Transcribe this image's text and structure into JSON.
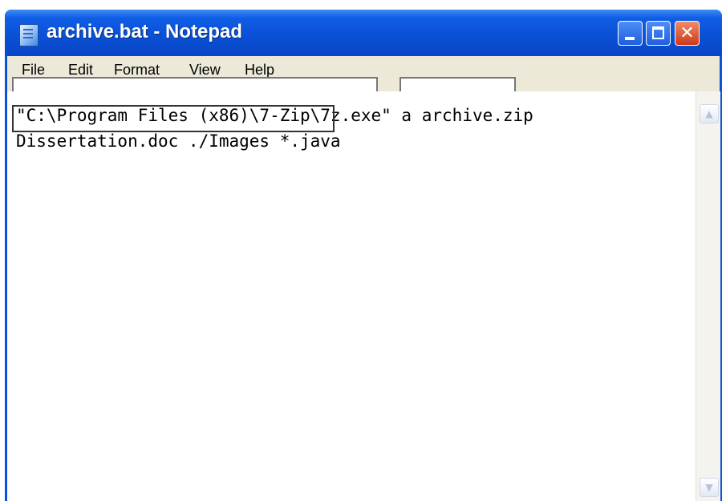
{
  "window": {
    "title": "archive.bat - Notepad",
    "app_icon": "notepad-icon",
    "controls": {
      "minimize_icon": "minimize-icon",
      "maximize_icon": "maximize-icon",
      "close_icon": "close-icon",
      "close_glyph": "✕"
    }
  },
  "menubar": {
    "items": [
      {
        "label": "File"
      },
      {
        "label": "Edit"
      },
      {
        "label": "Format"
      },
      {
        "label": "View"
      },
      {
        "label": "Help"
      }
    ]
  },
  "editor": {
    "lines": [
      "\"C:\\Program Files (x86)\\7-Zip\\7z.exe\" a archive.zip",
      "Dissertation.doc ./Images *.java"
    ]
  },
  "scrollbar": {
    "up_icon": "chevron-up-icon",
    "down_icon": "chevron-down-icon",
    "up_glyph": "▲",
    "down_glyph": "▼"
  },
  "colors": {
    "titlebar": "#0a4fd4",
    "menubar": "#ece9d8",
    "close_button": "#cc3a1a"
  }
}
